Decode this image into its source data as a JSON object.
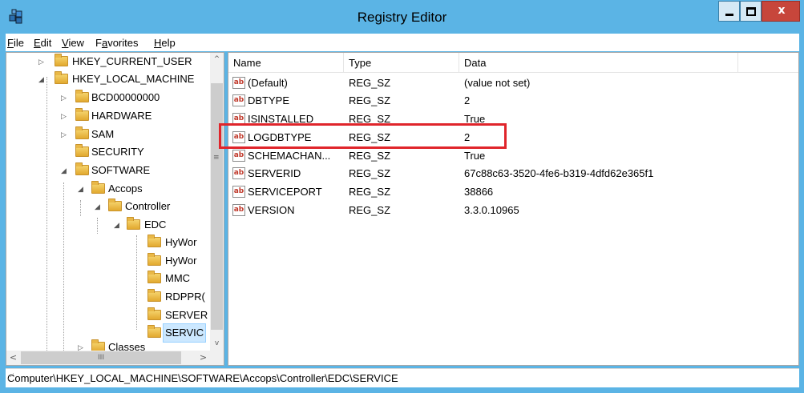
{
  "window": {
    "title": "Registry Editor"
  },
  "menu": [
    {
      "mnemonic": "F",
      "rest": "ile"
    },
    {
      "mnemonic": "E",
      "rest": "dit"
    },
    {
      "mnemonic": "V",
      "rest": "iew"
    },
    {
      "pre": "F",
      "mnemonic": "a",
      "rest": "vorites"
    },
    {
      "mnemonic": "H",
      "rest": "elp"
    }
  ],
  "tree": {
    "nodes": [
      {
        "label": "HKEY_CURRENT_USER"
      },
      {
        "label": "HKEY_LOCAL_MACHINE"
      },
      {
        "label": "BCD00000000"
      },
      {
        "label": "HARDWARE"
      },
      {
        "label": "SAM"
      },
      {
        "label": "SECURITY"
      },
      {
        "label": "SOFTWARE"
      },
      {
        "label": "Accops"
      },
      {
        "label": "Controller"
      },
      {
        "label": "EDC"
      },
      {
        "label": "HyWor"
      },
      {
        "label": "HyWor"
      },
      {
        "label": "MMC"
      },
      {
        "label": "RDPPR("
      },
      {
        "label": "SERVER"
      },
      {
        "label": "SERVIC"
      },
      {
        "label": "Classes"
      }
    ]
  },
  "list": {
    "columns": {
      "name": "Name",
      "type": "Type",
      "data": "Data"
    },
    "rows": [
      {
        "name": "(Default)",
        "type": "REG_SZ",
        "data": "(value not set)"
      },
      {
        "name": "DBTYPE",
        "type": "REG_SZ",
        "data": "2"
      },
      {
        "name": "ISINSTALLED",
        "type": "REG_SZ",
        "data": "True"
      },
      {
        "name": "LOGDBTYPE",
        "type": "REG_SZ",
        "data": "2"
      },
      {
        "name": "SCHEMACHAN...",
        "type": "REG_SZ",
        "data": "True"
      },
      {
        "name": "SERVERID",
        "type": "REG_SZ",
        "data": "67c88c63-3520-4fe6-b319-4dfd62e365f1"
      },
      {
        "name": "SERVICEPORT",
        "type": "REG_SZ",
        "data": "38866"
      },
      {
        "name": "VERSION",
        "type": "REG_SZ",
        "data": "3.3.0.10965"
      }
    ],
    "string_icon_text": "ab"
  },
  "status": {
    "path": "Computer\\HKEY_LOCAL_MACHINE\\SOFTWARE\\Accops\\Controller\\EDC\\SERVICE"
  },
  "colors": {
    "titlebar": "#5bb4e5",
    "highlight": "#e0252b",
    "close": "#c7463b"
  }
}
